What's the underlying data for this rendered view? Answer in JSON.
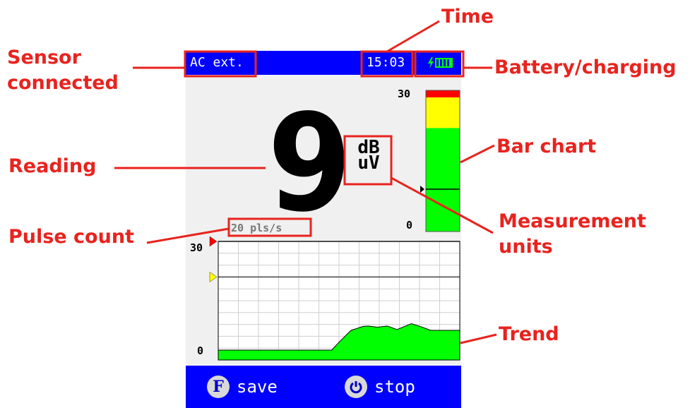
{
  "device": {
    "sensor": "AC ext.",
    "time": "15:03",
    "reading": "9",
    "units": {
      "line1": "dB",
      "line2": "uV"
    },
    "pulse": "20 pls/s",
    "bar_scale": {
      "max": "30",
      "min": "0"
    },
    "trend_scale": {
      "max": "30",
      "min": "0"
    },
    "footer": {
      "save_icon": "F",
      "save_label": "save",
      "stop_label": "stop"
    }
  },
  "callouts": {
    "sensor": [
      "Sensor",
      "connected"
    ],
    "time": "Time",
    "battery": "Battery/charging",
    "reading": "Reading",
    "bar_chart": "Bar chart",
    "units": [
      "Measurement",
      "units"
    ],
    "pulse": "Pulse count",
    "trend": "Trend"
  },
  "colors": {
    "annotation": "#e8231e",
    "screen_bar": "#0000ff",
    "level_green": "#00ff00",
    "level_yellow": "#ffff00",
    "level_red": "#ff0000"
  },
  "chart_data": [
    {
      "type": "bar",
      "title": "",
      "categories": [
        ""
      ],
      "values": [
        9
      ],
      "ylim": [
        0,
        30
      ],
      "zones": [
        {
          "color": "green",
          "from": 0,
          "to": 22
        },
        {
          "color": "yellow",
          "from": 22,
          "to": 28.5
        },
        {
          "color": "red",
          "from": 28.5,
          "to": 30
        }
      ],
      "marker": 9
    },
    {
      "type": "area",
      "title": "",
      "x": [
        0,
        10,
        20,
        30,
        40,
        47,
        50,
        55,
        60,
        62,
        66,
        70,
        74,
        76,
        80,
        84,
        88,
        90,
        100
      ],
      "y": [
        2.5,
        2.5,
        2.5,
        2.5,
        2.5,
        2.5,
        4.5,
        7.5,
        8.5,
        8.6,
        8.3,
        8.6,
        7.7,
        8.2,
        9.2,
        8.4,
        7.5,
        7.5,
        7.5
      ],
      "ylim": [
        0,
        30
      ],
      "grid": true,
      "markers": [
        {
          "value": 30,
          "color": "red"
        },
        {
          "value": 21,
          "color": "yellow"
        }
      ]
    }
  ]
}
